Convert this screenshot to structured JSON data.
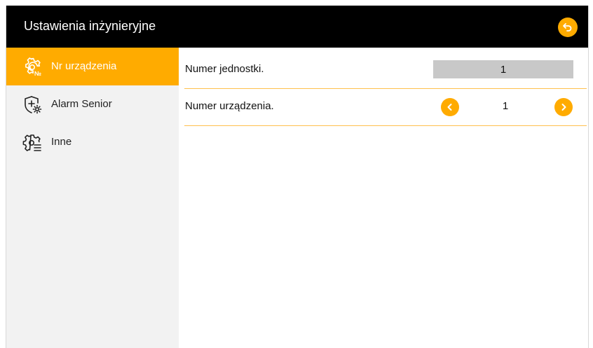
{
  "header": {
    "title": "Ustawienia inżynieryjne",
    "back_icon": "back-return-icon",
    "accent": "#ffab00",
    "background": "#000000"
  },
  "sidebar": {
    "items": [
      {
        "label": "Nr urządzenia",
        "icon": "gear-no-icon",
        "active": true
      },
      {
        "label": "Alarm Senior",
        "icon": "shield-plus-gear-icon",
        "active": false
      },
      {
        "label": "Inne",
        "icon": "gear-list-icon",
        "active": false
      }
    ]
  },
  "main": {
    "unit_number": {
      "label": "Numer jednostki.",
      "value": "1"
    },
    "device_number": {
      "label": "Numer urządzenia.",
      "value": "1"
    }
  },
  "colors": {
    "active_item": "#ffab00",
    "sidebar_bg": "#f2f2f2",
    "value_box_bg": "#c8c8c8",
    "divider": "#ffc04d"
  }
}
